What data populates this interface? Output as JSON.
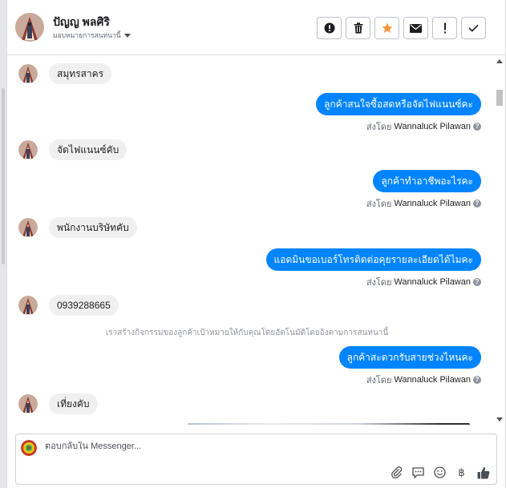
{
  "header": {
    "contact_name": "ปัญญ พลศิริ",
    "subtitle": "มอบหมายการสนทนานี้",
    "toolbar": [
      {
        "name": "alert-circle-icon"
      },
      {
        "name": "trash-icon"
      },
      {
        "name": "star-icon",
        "color": "#f7923a"
      },
      {
        "name": "envelope-icon"
      },
      {
        "name": "exclamation-icon"
      },
      {
        "name": "check-icon"
      }
    ]
  },
  "chat": {
    "messages": [
      {
        "dir": "in",
        "text": "สมุทรสาคร"
      },
      {
        "dir": "out",
        "text": "ลูกค้าสนใจซื้อสดหรือจัดไฟแนนซ์คะ",
        "sent_prefix": "ส่งโดย",
        "sent_by": "Wannaluck Pilawan"
      },
      {
        "dir": "in",
        "text": "จัดไฟแนนซ์คับ"
      },
      {
        "dir": "out",
        "text": "ลูกค้าทำอาชีพอะไรคะ",
        "sent_prefix": "ส่งโดย",
        "sent_by": "Wannaluck Pilawan"
      },
      {
        "dir": "in",
        "text": "พนักงานบริษัทคับ"
      },
      {
        "dir": "out",
        "text": "แอดมินขอเบอร์โทรติดต่อคุยรายละเอียดได้ไมคะ",
        "sent_prefix": "ส่งโดย",
        "sent_by": "Wannaluck Pilawan"
      },
      {
        "dir": "in",
        "text": "0939288665"
      },
      {
        "dir": "system",
        "text": "เราสร้างกิจกรรมของลูกค้าเป้าหมายให้กับคุณโดยอัตโนมัติโดยอิงตามการสนทนานี้"
      },
      {
        "dir": "out",
        "text": "ลูกค้าสะดวกรับสายช่วงไหนคะ",
        "sent_prefix": "ส่งโดย",
        "sent_by": "Wannaluck Pilawan"
      },
      {
        "dir": "in",
        "text": "เที่ยงคับ"
      }
    ]
  },
  "composer": {
    "placeholder": "ตอบกลับใน Messenger...",
    "tools": [
      {
        "name": "paperclip-icon"
      },
      {
        "name": "speech-bubble-icon"
      },
      {
        "name": "emoji-icon"
      },
      {
        "name": "baht-icon",
        "glyph": "฿"
      },
      {
        "name": "thumbs-up-icon"
      }
    ]
  },
  "colors": {
    "accent": "#0084ff",
    "star": "#f7923a"
  }
}
